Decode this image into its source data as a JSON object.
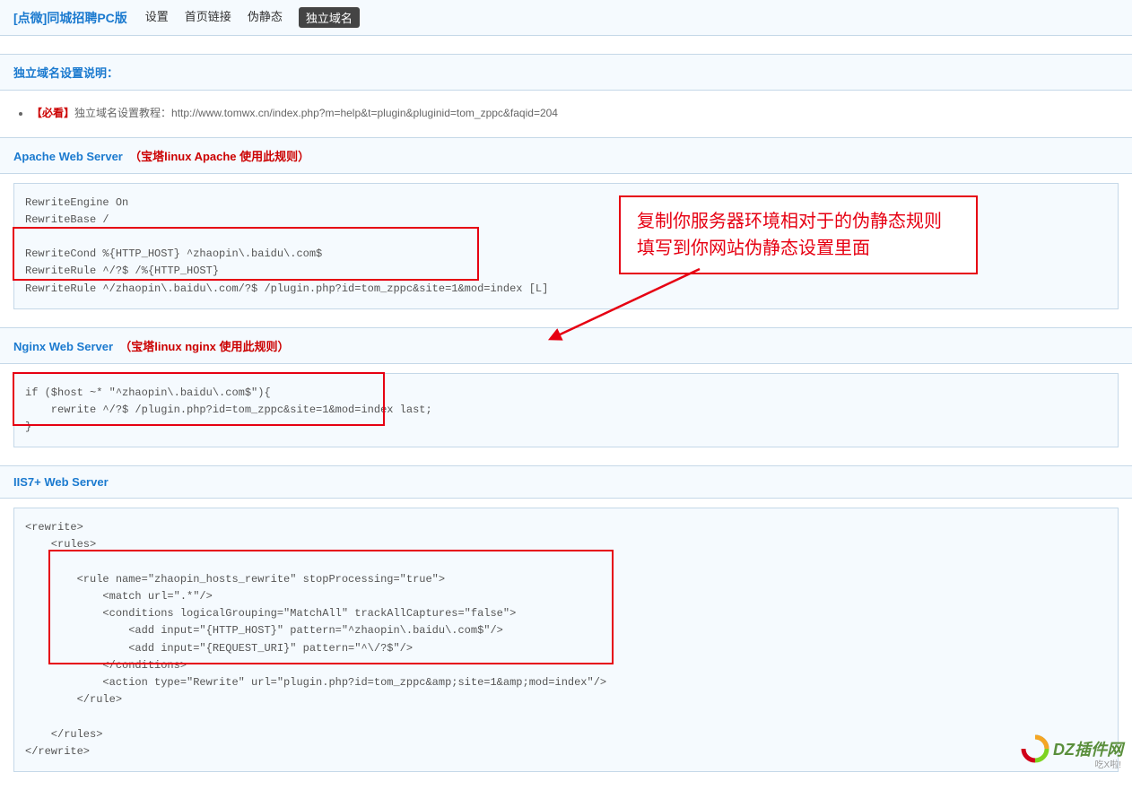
{
  "header": {
    "title": "[点微]同城招聘PC版",
    "tabs": [
      "设置",
      "首页链接",
      "伪静态",
      "独立域名"
    ],
    "active_tab_index": 3
  },
  "info_section": {
    "title": "独立域名设置说明：",
    "items": [
      {
        "tag": "【必看】",
        "label": "独立域名设置教程：",
        "url": "http://www.tomwx.cn/index.php?m=help&t=plugin&pluginid=tom_zppc&faqid=204"
      }
    ]
  },
  "apache": {
    "title": "Apache Web Server",
    "note": "（宝塔linux Apache 使用此规则）",
    "code": "RewriteEngine On\nRewriteBase /\n\nRewriteCond %{HTTP_HOST} ^zhaopin\\.baidu\\.com$\nRewriteRule ^/?$ /%{HTTP_HOST}\nRewriteRule ^/zhaopin\\.baidu\\.com/?$ /plugin.php?id=tom_zppc&site=1&mod=index [L]"
  },
  "nginx": {
    "title": "Nginx Web Server",
    "note": "（宝塔linux nginx 使用此规则）",
    "code": "if ($host ~* \"^zhaopin\\.baidu\\.com$\"){\n    rewrite ^/?$ /plugin.php?id=tom_zppc&site=1&mod=index last;\n}"
  },
  "iis": {
    "title": "IIS7+ Web Server",
    "code": "<rewrite>\n    <rules>\n\n        <rule name=\"zhaopin_hosts_rewrite\" stopProcessing=\"true\">\n            <match url=\".*\"/>\n            <conditions logicalGrouping=\"MatchAll\" trackAllCaptures=\"false\">\n                <add input=\"{HTTP_HOST}\" pattern=\"^zhaopin\\.baidu\\.com$\"/>\n                <add input=\"{REQUEST_URI}\" pattern=\"^\\/?$\"/>\n            </conditions>\n            <action type=\"Rewrite\" url=\"plugin.php?id=tom_zppc&amp;site=1&amp;mod=index\"/>\n        </rule>\n\n    </rules>\n</rewrite>"
  },
  "annotation": {
    "line1": "复制你服务器环境相对于的伪静态规则",
    "line2": "填写到你网站伪静态设置里面"
  },
  "watermark": {
    "text": "DZ插件网",
    "sub": "吃X啦!"
  }
}
